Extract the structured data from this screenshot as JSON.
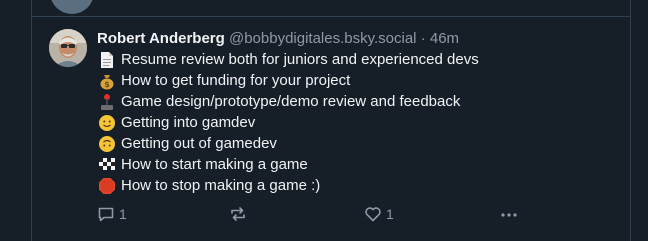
{
  "post": {
    "author_name": "Robert Anderberg",
    "handle": "@bobbydigitales.bsky.social",
    "separator": "·",
    "time": "46m",
    "lines": [
      {
        "icon": "page-icon",
        "text": "Resume review both for juniors and experienced devs"
      },
      {
        "icon": "money-bag-icon",
        "text": "How to get funding for your project"
      },
      {
        "icon": "joystick-icon",
        "text": "Game design/prototype/demo review and feedback"
      },
      {
        "icon": "slight-smile-icon",
        "text": "Getting into gamdev"
      },
      {
        "icon": "upside-down-face-icon",
        "text": "Getting out of gamedev"
      },
      {
        "icon": "checkered-flag-icon",
        "text": "How to start making a game"
      },
      {
        "icon": "stop-sign-icon",
        "text": "How to stop making a game :)"
      }
    ]
  },
  "actions": {
    "reply_count": "1",
    "like_count": "1"
  },
  "colors": {
    "background": "#161e27",
    "text": "#f1f3f5",
    "muted": "#8d9aa8",
    "border": "#2e4052"
  }
}
